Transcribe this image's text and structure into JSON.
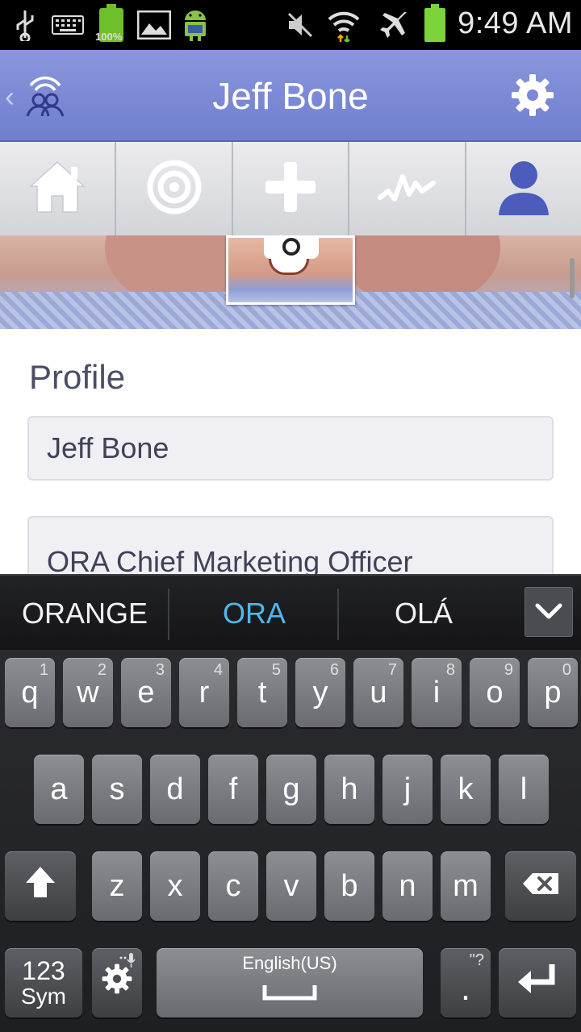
{
  "status_bar": {
    "time": "9:49 AM",
    "battery_left_text": "100%",
    "icons": [
      "usb-icon",
      "keyboard-icon",
      "battery-full-icon",
      "gallery-icon",
      "android-icon",
      "mute-icon",
      "wifi-icon",
      "airplane-mode-icon",
      "battery-icon"
    ]
  },
  "title_bar": {
    "title": "Jeff Bone",
    "back_icon": "chevron-left-icon",
    "app_icon": "group-broadcast-icon",
    "settings_icon": "gear-icon"
  },
  "tabs": [
    {
      "name": "home",
      "icon": "home-icon"
    },
    {
      "name": "target",
      "icon": "target-icon"
    },
    {
      "name": "add",
      "icon": "plus-icon"
    },
    {
      "name": "activity",
      "icon": "activity-icon"
    },
    {
      "name": "profile",
      "icon": "person-icon",
      "active": true
    }
  ],
  "profile": {
    "section_title": "Profile",
    "name_value": "Jeff Bone",
    "title_value": "ORA Chief Marketing Officer"
  },
  "keyboard": {
    "suggestions": [
      "ORANGE",
      "ORA",
      "OLÁ"
    ],
    "row1": [
      {
        "k": "q",
        "n": "1"
      },
      {
        "k": "w",
        "n": "2"
      },
      {
        "k": "e",
        "n": "3"
      },
      {
        "k": "r",
        "n": "4"
      },
      {
        "k": "t",
        "n": "5"
      },
      {
        "k": "y",
        "n": "6"
      },
      {
        "k": "u",
        "n": "7"
      },
      {
        "k": "i",
        "n": "8"
      },
      {
        "k": "o",
        "n": "9"
      },
      {
        "k": "p",
        "n": "0"
      }
    ],
    "row2": [
      "a",
      "s",
      "d",
      "f",
      "g",
      "h",
      "j",
      "k",
      "l"
    ],
    "row3": [
      "z",
      "x",
      "c",
      "v",
      "b",
      "n",
      "m"
    ],
    "sym_top": "123",
    "sym_bottom": "Sym",
    "space_label": "English(US)",
    "period": ".",
    "period_hint": "\"?",
    "accent_color": "#4fb7ee"
  }
}
